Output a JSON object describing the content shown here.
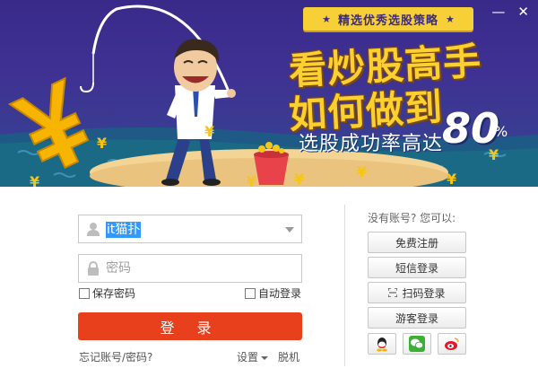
{
  "banner": {
    "ribbon_text": "精选优秀选股策略",
    "ribbon_star": "★",
    "headline_line1": "看炒股高手",
    "headline_line2": "如何做到",
    "subline": "选股成功率高达",
    "percent_value": "80",
    "percent_sign": "%",
    "yen_symbol": "¥"
  },
  "window_controls": {
    "minimize": "—",
    "close": "✕"
  },
  "login": {
    "username_value": "it猫扑",
    "password_placeholder": "密码",
    "remember_label": "保存密码",
    "auto_login_label": "自动登录",
    "login_button": "登 录",
    "forgot_link": "忘记账号/密码?",
    "settings_link": "设置",
    "offline_link": "脱机"
  },
  "side": {
    "no_account_text": "没有账号? 您可以:",
    "register_button": "免费注册",
    "sms_login_button": "短信登录",
    "scan_login_button": "扫码登录",
    "guest_login_button": "游客登录",
    "social": [
      "qq",
      "wechat",
      "weibo"
    ]
  },
  "colors": {
    "banner_bg": "#3a2f8e",
    "headline": "#fcd02e",
    "login_button": "#e8401c",
    "selection": "#3399ff",
    "wechat": "#3cb034",
    "weibo": "#e6162d"
  },
  "icons": [
    "user-icon",
    "lock-icon",
    "chevron-down-icon",
    "scan-icon",
    "qq-icon",
    "wechat-icon",
    "weibo-icon",
    "minimize-icon",
    "close-icon"
  ]
}
